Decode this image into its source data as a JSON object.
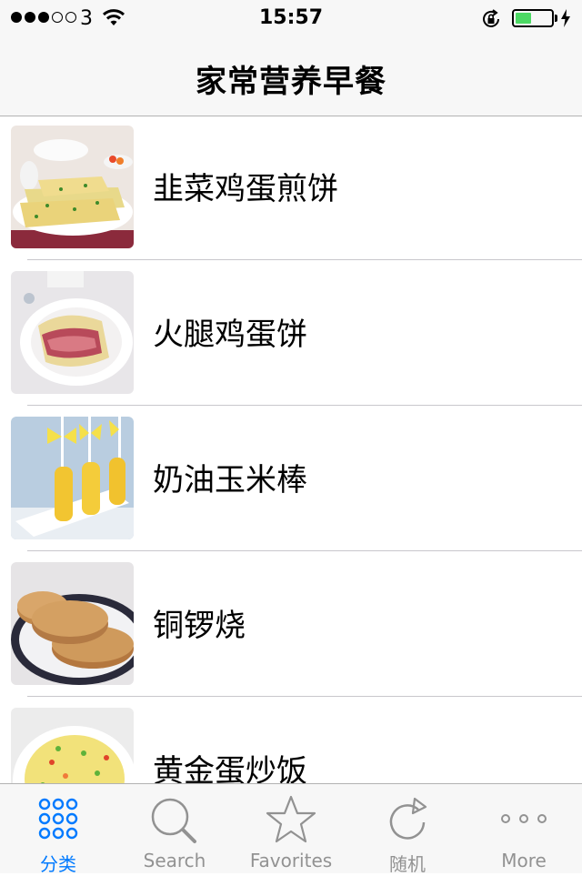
{
  "status_bar": {
    "signal_bars_filled": 3,
    "signal_bars_total": 5,
    "carrier": "3",
    "time": "15:57",
    "battery_level_percent": 45,
    "icons": [
      "wifi-icon",
      "rotation-lock-icon",
      "battery-icon",
      "charging-bolt-icon"
    ]
  },
  "nav": {
    "title": "家常营养早餐"
  },
  "recipes": [
    {
      "name": "韭菜鸡蛋煎饼",
      "thumb": "chive-egg-pancake"
    },
    {
      "name": "火腿鸡蛋饼",
      "thumb": "ham-egg-roll"
    },
    {
      "name": "奶油玉米棒",
      "thumb": "buttered-corn-sticks"
    },
    {
      "name": "铜锣烧",
      "thumb": "dorayaki"
    },
    {
      "name": "黄金蛋炒饭",
      "thumb": "golden-egg-fried-rice"
    }
  ],
  "tabs": [
    {
      "label": "分类",
      "icon": "grid-dots-icon",
      "active": true
    },
    {
      "label": "Search",
      "icon": "search-icon",
      "active": false
    },
    {
      "label": "Favorites",
      "icon": "star-icon",
      "active": false
    },
    {
      "label": "随机",
      "icon": "refresh-icon",
      "active": false
    },
    {
      "label": "More",
      "icon": "more-dots-icon",
      "active": false
    }
  ],
  "colors": {
    "accent": "#007aff",
    "tab_inactive": "#929292",
    "bar_background": "#f7f7f7",
    "battery_fill": "#4cd964"
  }
}
